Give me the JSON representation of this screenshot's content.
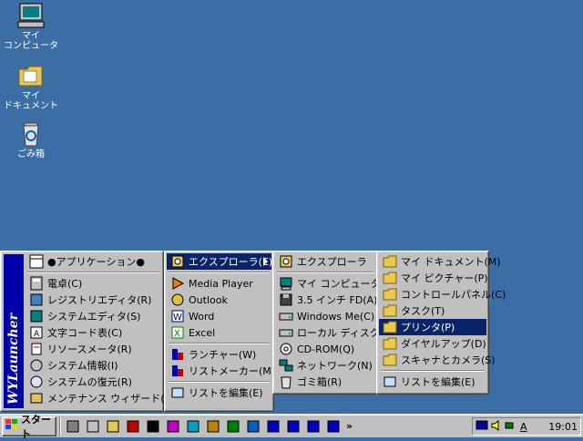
{
  "desktop": {
    "icons": [
      {
        "label": "マイ\nコンピュータ",
        "icon": "computer-icon"
      },
      {
        "label": "マイ\nドキュメント",
        "icon": "folder-icon"
      },
      {
        "label": "ごみ箱",
        "icon": "recycle-bin-icon"
      }
    ]
  },
  "launcher": {
    "banner": "WYLauncher",
    "header": "●アプリケーション●",
    "items": [
      {
        "label": "電卓(C)",
        "icon": "calculator-icon"
      },
      {
        "label": "レジストリエディタ(R)",
        "icon": "regedit-icon"
      },
      {
        "label": "システムエディタ(S)",
        "icon": "sysedit-icon"
      },
      {
        "label": "文字コード表(C)",
        "icon": "charmap-icon"
      },
      {
        "label": "リソースメータ(R)",
        "icon": "resource-meter-icon"
      },
      {
        "label": "システム情報(I)",
        "icon": "system-info-icon"
      },
      {
        "label": "システムの復元(R)",
        "icon": "system-restore-icon"
      },
      {
        "label": "メンテナンス ウィザード(M)",
        "icon": "maintenance-wizard-icon"
      }
    ]
  },
  "submenu1": {
    "items": [
      {
        "label": "エクスプローラ(E)",
        "icon": "explorer-icon",
        "selected": true,
        "has_arrow": true
      },
      {
        "label": "Media Player",
        "icon": "media-player-icon"
      },
      {
        "label": "Outlook",
        "icon": "outlook-icon"
      },
      {
        "label": "Word",
        "icon": "word-icon"
      },
      {
        "label": "Excel",
        "icon": "excel-icon"
      },
      {
        "label": "ランチャー(W)",
        "icon": "launcher-icon"
      },
      {
        "label": "リストメーカー(M)",
        "icon": "list-maker-icon"
      },
      {
        "label": "リストを編集(E)",
        "icon": "edit-list-icon"
      }
    ]
  },
  "submenu2": {
    "items": [
      {
        "label": "エクスプローラ",
        "icon": "explorer-icon"
      },
      {
        "label": "マイ コンピュータ(M)",
        "icon": "computer-icon"
      },
      {
        "label": "3.5 インチ FD(A)",
        "icon": "floppy-icon"
      },
      {
        "label": "Windows Me(C)",
        "icon": "drive-icon"
      },
      {
        "label": "ローカル ディスク(D)",
        "icon": "drive-icon"
      },
      {
        "label": "CD-ROM(Q)",
        "icon": "cdrom-icon"
      },
      {
        "label": "ネットワーク(N)",
        "icon": "network-icon"
      },
      {
        "label": "ゴミ箱(R)",
        "icon": "recycle-bin-icon"
      }
    ]
  },
  "submenu3": {
    "items": [
      {
        "label": "マイ ドキュメント(M)",
        "icon": "folder-icon"
      },
      {
        "label": "マイ ピクチャー(P)",
        "icon": "folder-icon"
      },
      {
        "label": "コントロールパネル(C)",
        "icon": "folder-icon"
      },
      {
        "label": "タスク(T)",
        "icon": "folder-icon"
      },
      {
        "label": "プリンタ(P)",
        "icon": "folder-icon",
        "selected": true
      },
      {
        "label": "ダイヤルアップ(D)",
        "icon": "folder-icon"
      },
      {
        "label": "スキャナとカメラ(S)",
        "icon": "folder-icon"
      },
      {
        "label": "リストを編集(E)",
        "icon": "edit-list-icon"
      }
    ]
  },
  "taskbar": {
    "start_label": "スタート",
    "quick_launch": [
      "toolbar-icon-1",
      "toolbar-icon-2",
      "folder-icon",
      "pen-icon",
      "music-icon",
      "atom-icon",
      "infinity-icon",
      "paint-icon",
      "globe-icon",
      "square-icon",
      "next-icon",
      "prev-icon",
      "play-icon",
      "refresh-icon"
    ],
    "overflow": "»",
    "tray_ime": "A",
    "clock": "19:01"
  },
  "colors": {
    "desktop": "#3a6ea5",
    "selection": "#0a246a",
    "banner": "#0000a8"
  }
}
